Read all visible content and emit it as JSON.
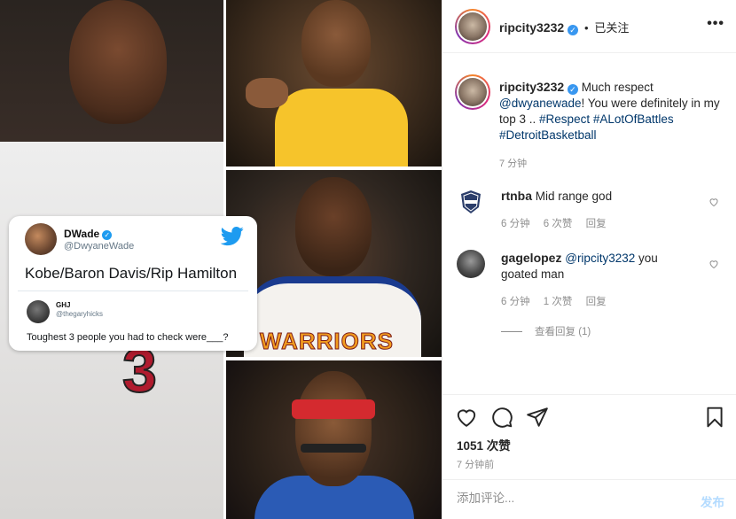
{
  "header": {
    "username": "ripcity3232",
    "separator": "•",
    "follow_status": "已关注",
    "more": "•••"
  },
  "caption": {
    "username": "ripcity3232",
    "text_1": "Much respect",
    "mention": "@dwyanewade",
    "text_2": "! You were definitely in my top 3 ..",
    "hashtags": [
      "#Respect",
      "#ALotOfBattles",
      "#DetroitBasketball"
    ],
    "time": "7 分钟"
  },
  "comments": [
    {
      "username": "rtnba",
      "text": "Mid range god",
      "time": "6 分钟",
      "likes": "6 次赞",
      "reply": "回复"
    },
    {
      "username": "gagelopez",
      "mention": "@ripcity3232",
      "text": "you goated man",
      "time": "6 分钟",
      "likes": "1 次赞",
      "reply": "回复"
    }
  ],
  "view_replies": "查看回复 (1)",
  "likes_count": "1051 次赞",
  "post_time": "7 分钟前",
  "comment_input": {
    "placeholder": "添加评论..."
  },
  "post_button": "发布",
  "media": {
    "tweet": {
      "name": "DWade",
      "handle": "@DwyaneWade",
      "text": "Kobe/Baron Davis/Rip Hamilton",
      "quoted_name": "GHJ",
      "quoted_handle": "@thegaryhicks",
      "quoted_text": "Toughest 3 people you had to check were___?"
    },
    "jersey_number": "3",
    "warriors_text": "WARRIORS"
  },
  "colors": {
    "link": "#00376b",
    "muted": "#8e8e8e",
    "verified": "#3897f0",
    "twitter": "#1d9bf0"
  }
}
